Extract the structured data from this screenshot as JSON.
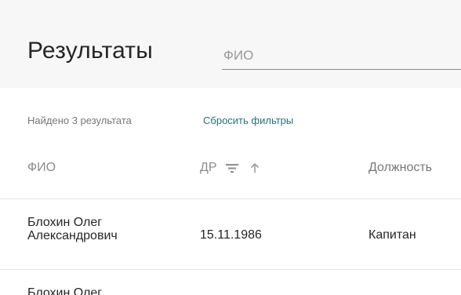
{
  "header": {
    "title": "Результаты",
    "search": {
      "placeholder": "ФИО",
      "value": ""
    }
  },
  "summary": {
    "found_text": "Найдено 3 результата",
    "reset_filters_label": "Сбросить фильтры"
  },
  "table": {
    "columns": [
      {
        "label": "ФИО"
      },
      {
        "label": "ДР",
        "filter_icon": "filter-icon",
        "sort_icon": "arrow-up-icon"
      },
      {
        "label": "Должность"
      }
    ],
    "rows": [
      {
        "name": "Блохин Олег Александрович",
        "birth_date": "15.11.1986",
        "position": "Капитан"
      },
      {
        "name": "Блохин Олег"
      }
    ]
  },
  "colors": {
    "header_bg": "#f7f7f7",
    "link": "#2a6f7a",
    "muted_text": "#8c8c8c"
  }
}
